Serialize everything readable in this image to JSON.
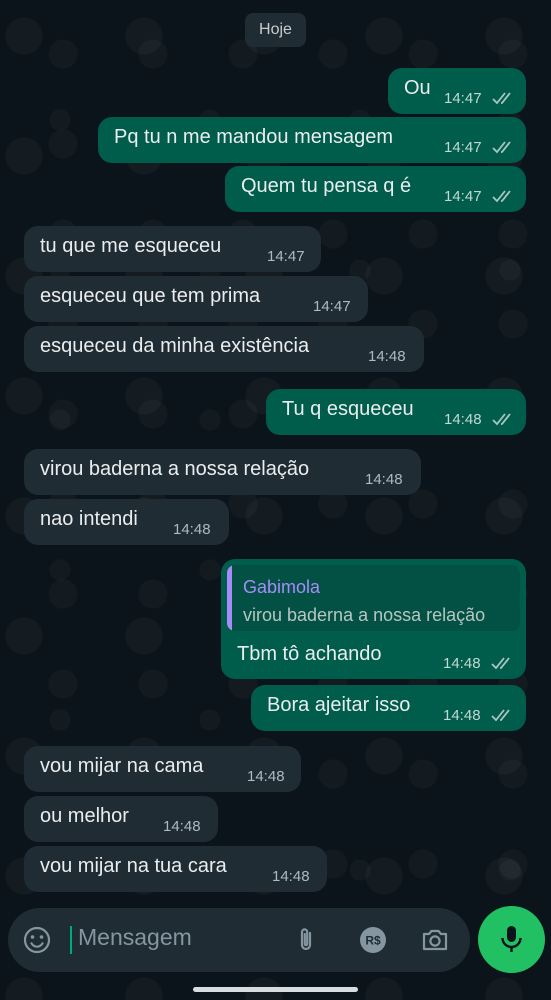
{
  "chat": {
    "date_label": "Hoje",
    "messages": [
      {
        "dir": "out",
        "text": "Ou",
        "time": "14:47"
      },
      {
        "dir": "out",
        "text": "Pq tu n me mandou mensagem",
        "time": "14:47"
      },
      {
        "dir": "out",
        "text": "Quem tu pensa q é",
        "time": "14:47"
      },
      {
        "dir": "in",
        "text": "tu que me esqueceu",
        "time": "14:47"
      },
      {
        "dir": "in",
        "text": "esqueceu que tem prima",
        "time": "14:47"
      },
      {
        "dir": "in",
        "text": "esqueceu da minha existência",
        "time": "14:48"
      },
      {
        "dir": "out",
        "text": "Tu q esqueceu",
        "time": "14:48"
      },
      {
        "dir": "in",
        "text": "virou baderna a nossa relação",
        "time": "14:48"
      },
      {
        "dir": "in",
        "text": "nao intendi",
        "time": "14:48"
      },
      {
        "dir": "out",
        "text": "Tbm tô achando",
        "time": "14:48",
        "quote": {
          "author": "Gabimola",
          "text": "virou baderna a nossa relação"
        }
      },
      {
        "dir": "out",
        "text": "Bora ajeitar isso",
        "time": "14:48"
      },
      {
        "dir": "in",
        "text": "vou mijar na cama",
        "time": "14:48"
      },
      {
        "dir": "in",
        "text": "ou melhor",
        "time": "14:48"
      },
      {
        "dir": "in",
        "text": "vou mijar na tua cara",
        "time": "14:48"
      }
    ]
  },
  "input": {
    "placeholder": "Mensagem",
    "icons": [
      "emoji-icon",
      "attach-icon",
      "payment-icon",
      "camera-icon"
    ],
    "payment_glyph": "R$"
  },
  "mic": {
    "icon": "microphone-icon"
  },
  "colors": {
    "outgoing_bubble": "#005c4b",
    "incoming_bubble": "#202c33",
    "accent": "#21c063",
    "quote_author": "#a78bfa"
  }
}
